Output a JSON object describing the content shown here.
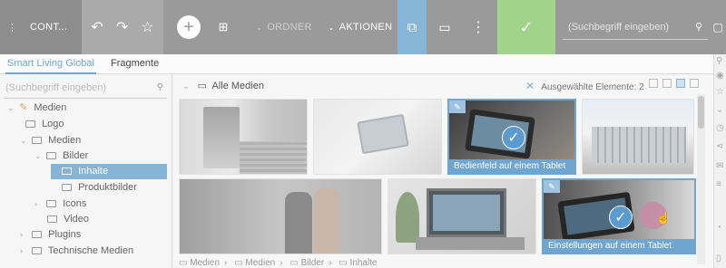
{
  "toolbar": {
    "app_label": "CONT...",
    "ordner_label": "ORDNER",
    "aktionen_label": "AKTIONEN",
    "search_placeholder": "(Suchbegriff eingeben)",
    "colors": {
      "bar": "#9a9a9a",
      "accent_blue": "#87b5d8",
      "confirm_green": "#9fd48a"
    }
  },
  "tabs": [
    {
      "label": "Smart Living Global",
      "active": true
    },
    {
      "label": "Fragmente",
      "active": false
    }
  ],
  "sidebar": {
    "search_placeholder": "(Suchbegriff eingeben)",
    "tree": [
      {
        "label": "Medien",
        "icon": "pencil-icon",
        "expanded": true,
        "level": 0
      },
      {
        "label": "Logo",
        "icon": "folder-icon",
        "level": 1
      },
      {
        "label": "Medien",
        "icon": "folder-icon",
        "expanded": true,
        "level": 1
      },
      {
        "label": "Bilder",
        "icon": "folder-icon",
        "expanded": true,
        "level": 2
      },
      {
        "label": "Inhalte",
        "icon": "folder-icon",
        "selected": true,
        "level": 3
      },
      {
        "label": "Produktbilder",
        "icon": "folder-icon",
        "level": 3
      },
      {
        "label": "Icons",
        "icon": "folder-icon",
        "expanded": false,
        "level": 2
      },
      {
        "label": "Video",
        "icon": "folder-icon",
        "level": 2
      },
      {
        "label": "Plugins",
        "icon": "folder-icon",
        "expanded": false,
        "level": 0
      },
      {
        "label": "Technische Medien",
        "icon": "folder-icon",
        "expanded": false,
        "level": 0
      }
    ]
  },
  "main": {
    "folder_label": "Alle Medien",
    "selected_label": "Ausgewählte Elemente: 2",
    "tiles": [
      {
        "caption": "",
        "selected": false
      },
      {
        "caption": "",
        "selected": false
      },
      {
        "caption": "Bedienfeld auf einem Tablet",
        "selected": true
      },
      {
        "caption": "",
        "selected": false
      },
      {
        "caption": "",
        "selected": false
      },
      {
        "caption": "",
        "selected": false
      },
      {
        "caption": "Einstellungen auf einem Tablet",
        "selected": true
      }
    ],
    "breadcrumb": [
      "Medien",
      "Medien",
      "Bilder",
      "Inhalte"
    ]
  }
}
